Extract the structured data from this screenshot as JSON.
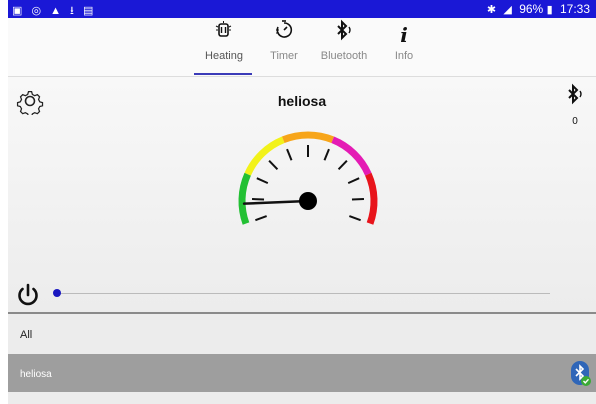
{
  "status_bar": {
    "battery": "96%",
    "time": "17:33",
    "bg_color": "#1a18d6"
  },
  "tabs": [
    {
      "label": "Heating",
      "icon": "heater-icon",
      "active": true
    },
    {
      "label": "Timer",
      "icon": "timer-icon",
      "active": false
    },
    {
      "label": "Bluetooth",
      "icon": "bluetooth-icon",
      "active": false
    },
    {
      "label": "Info",
      "icon": "info-icon",
      "active": false
    }
  ],
  "main": {
    "device_title": "heliosa",
    "bluetooth_count": "0",
    "gauge": {
      "colors": [
        "#22c033",
        "#f2f21a",
        "#f7a519",
        "#e41bb4",
        "#e8141b"
      ],
      "needle_level": 0.08
    },
    "power_slider_level": 0.0,
    "accent_color": "#1a18c0"
  },
  "list": {
    "section_label": "All",
    "devices": [
      {
        "name": "heliosa",
        "icon": "bluetooth-connected-icon"
      }
    ]
  }
}
